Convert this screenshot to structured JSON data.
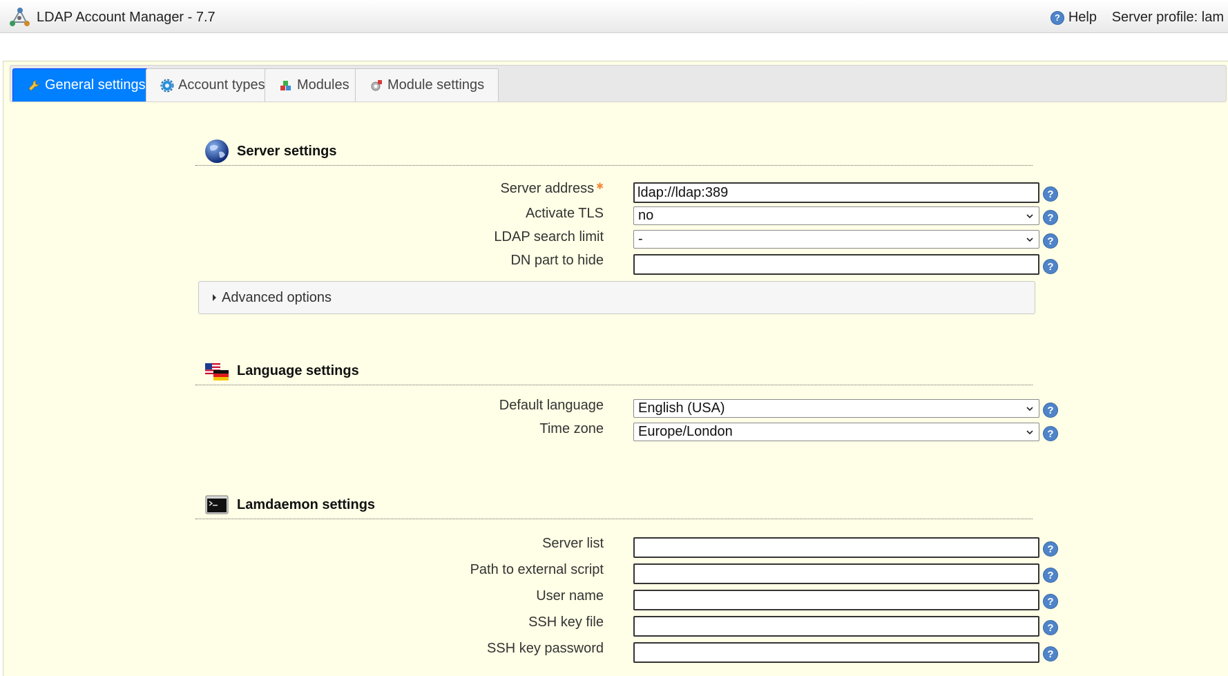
{
  "header": {
    "title": "LDAP Account Manager - 7.7",
    "help_label": "Help",
    "server_profile": "Server profile: lam"
  },
  "tabs": [
    {
      "label": "General settings",
      "icon": "wrench-icon",
      "active": true
    },
    {
      "label": "Account types",
      "icon": "gear-icon",
      "active": false
    },
    {
      "label": "Modules",
      "icon": "modules-icon",
      "active": false
    },
    {
      "label": "Module settings",
      "icon": "module-settings-icon",
      "active": false
    }
  ],
  "server_settings": {
    "title": "Server settings",
    "server_address_label": "Server address",
    "server_address_value": "ldap://ldap:389",
    "activate_tls_label": "Activate TLS",
    "activate_tls_value": "no",
    "search_limit_label": "LDAP search limit",
    "search_limit_value": "-",
    "dn_hide_label": "DN part to hide",
    "dn_hide_value": "",
    "advanced_label": "Advanced options"
  },
  "language_settings": {
    "title": "Language settings",
    "default_language_label": "Default language",
    "default_language_value": "English (USA)",
    "time_zone_label": "Time zone",
    "time_zone_value": "Europe/London"
  },
  "lamdaemon_settings": {
    "title": "Lamdaemon settings",
    "server_list_label": "Server list",
    "server_list_value": "",
    "script_path_label": "Path to external script",
    "script_path_value": "",
    "user_name_label": "User name",
    "user_name_value": "",
    "ssh_key_file_label": "SSH key file",
    "ssh_key_file_value": "",
    "ssh_key_password_label": "SSH key password",
    "ssh_key_password_value": ""
  },
  "colors": {
    "active_tab": "#007fff",
    "content_background": "#fffee6",
    "help_icon": "#4f84c9",
    "required_marker": "#f28c38"
  }
}
